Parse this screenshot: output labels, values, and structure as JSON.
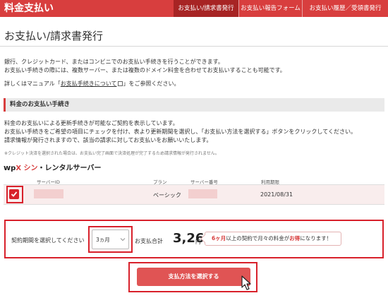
{
  "header": {
    "brand": "料金支払い",
    "tabs": [
      {
        "label": "お支払い/請求書発行",
        "active": true
      },
      {
        "label": "お支払い報告フォーム",
        "active": false
      },
      {
        "label": "お支払い履歴／受領書発行",
        "active": false
      }
    ]
  },
  "page": {
    "title": "お支払い/請求書発行",
    "intro_line1": "銀行、クレジットカード、またはコンビニでのお支払い手続きを行うことができます。",
    "intro_line2": "お支払い手続きの際には、複数サーバー、または複数のドメイン料金を合わせてお支払いすることも可能です。",
    "manual_prefix": "詳しくはマニュアル「",
    "manual_link": "お支払手続きについて",
    "manual_suffix": "」をご参照ください。"
  },
  "section": {
    "heading": "料金のお支払い手続き",
    "desc_line1": "料金のお支払いによる更新手続きが可能なご契約を表示しています。",
    "desc_line2": "お支払い手続きをご希望の項目にチェックを付け、表より更新期間を選択し、「お支払い方法を選択する」ボタンをクリックしてください。",
    "desc_line3": "請求情報が発行されますので、該当の請求に対してお支払いをお願いいたします。",
    "note": "※クレジット決済を選択された場合は、お支払い完了画面で決済処理が完了するため請求情報が発行されません。"
  },
  "product": {
    "logo_w": "w",
    "logo_p": "p",
    "logo_x": "X",
    "logo_shin": "シン",
    "logo_rest": "・レンタルサーバー"
  },
  "table": {
    "columns": [
      "サーバーID",
      "プラン",
      "サーバー番号",
      "利用期限"
    ],
    "rows": [
      {
        "checked": true,
        "server_id": "",
        "plan": "ベーシック",
        "server_number": "",
        "expiry": "2021/08/31"
      }
    ]
  },
  "payment": {
    "period_label": "契約期間を選択してください",
    "period_value": "3ヵ月",
    "total_label": "お支払合計",
    "total_value": "3,267",
    "currency": "円",
    "promo_part1": "6ヶ月",
    "promo_part2": "以上の契約で月々の料金が",
    "promo_part3": "お得",
    "promo_part4": "になります！",
    "submit_label": "支払方法を選択する"
  },
  "colors": {
    "brand_red": "#d83e3e",
    "highlight_red": "#d8212b",
    "button_red": "#e05454"
  }
}
